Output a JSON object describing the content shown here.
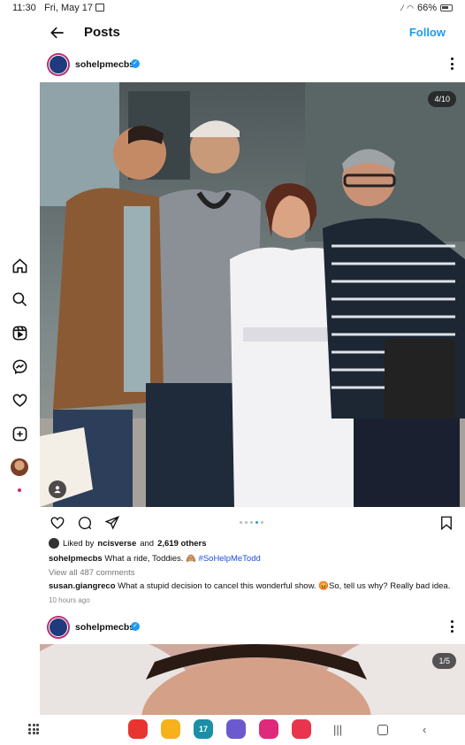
{
  "status": {
    "time": "11:30",
    "date": "Fri, May 17",
    "battery": "66%"
  },
  "header": {
    "title": "Posts",
    "follow_label": "Follow"
  },
  "post1": {
    "username": "sohelpmecbs",
    "counter": "4/10",
    "carousel_active": 3,
    "liked_by_prefix": "Liked by",
    "liked_by_user": "ncisverse",
    "liked_by_and": "and",
    "likes_count": "2,619 others",
    "caption_user": "sohelpmecbs",
    "caption_text": "What a ride, Toddies. 🙈",
    "caption_hashtag": "#SoHelpMeTodd",
    "view_all": "View all 487 comments",
    "comment_user": "susan.giangreco",
    "comment_text": "What a stupid decision to cancel this wonderful show. 😡So, tell us why? Really bad idea.",
    "time_ago": "10 hours ago"
  },
  "post2": {
    "username": "sohelpmecbs",
    "counter": "1/5"
  },
  "rail": {
    "items": [
      "home-icon",
      "search-icon",
      "reels-icon",
      "messenger-icon",
      "heart-icon",
      "create-icon",
      "profile-avatar"
    ]
  },
  "taskbar": {
    "apps": [
      {
        "name": "flipboard-app",
        "color": "#e8352f"
      },
      {
        "name": "files-app",
        "color": "#f5b21c"
      },
      {
        "name": "calendar-app",
        "color": "#1a8fa6",
        "label": "17"
      },
      {
        "name": "browser-app",
        "color": "#6a5acd"
      },
      {
        "name": "flower-app",
        "color": "#e0287c"
      },
      {
        "name": "camera-app",
        "color": "#e8344c"
      }
    ]
  },
  "colors": {
    "accent": "#1d9bf0",
    "hashtag": "#1d4ed8"
  }
}
